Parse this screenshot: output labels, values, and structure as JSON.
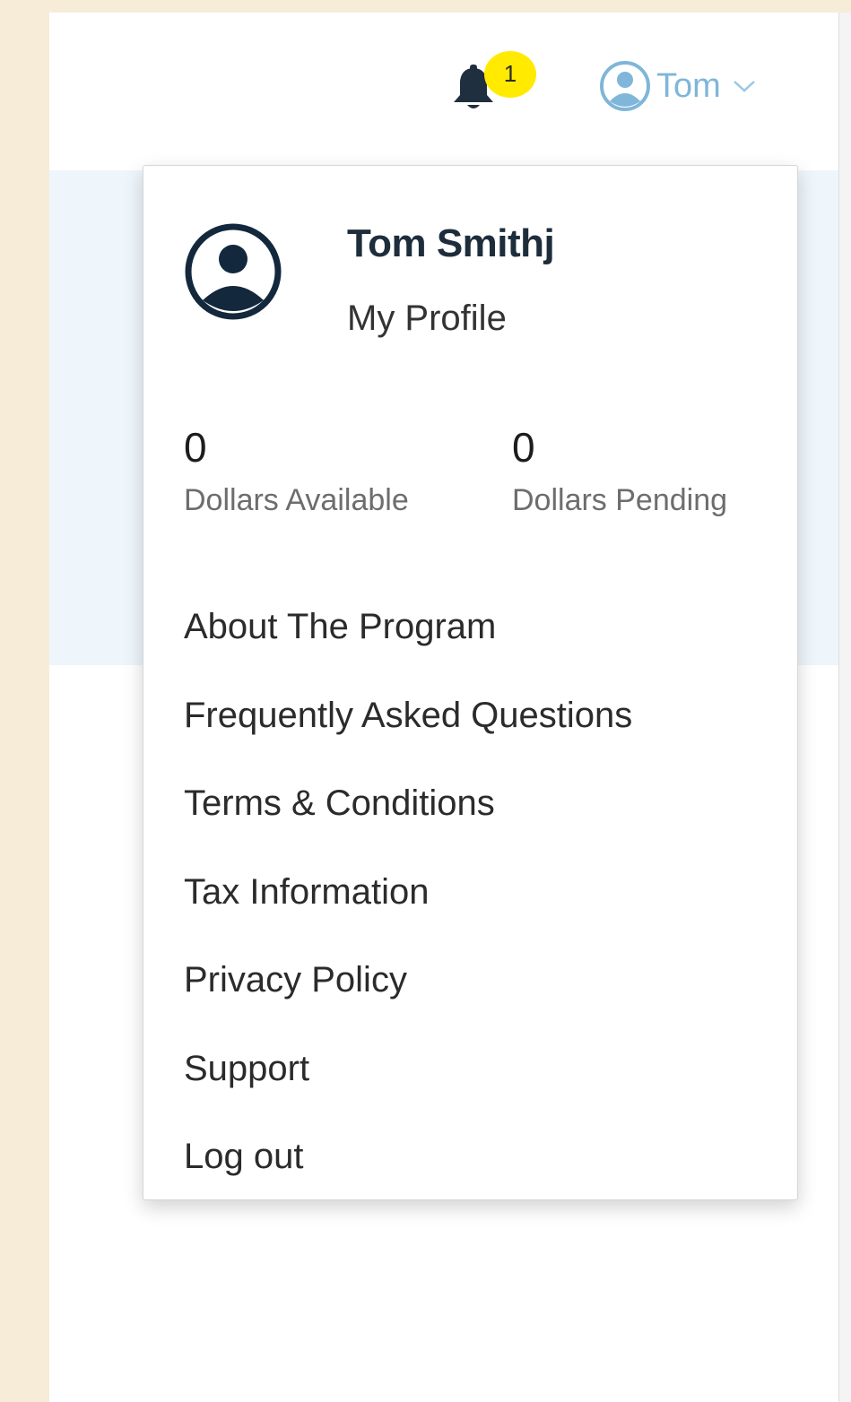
{
  "header": {
    "notifications": {
      "icon": "bell-icon",
      "count": "1",
      "badge_color": "#ffea00"
    },
    "user_menu": {
      "icon": "user-circle-icon",
      "name": "Tom",
      "chevron_icon": "chevron-down-icon",
      "accent_color": "#7fb6d9"
    }
  },
  "dropdown": {
    "avatar_icon": "user-circle-icon",
    "full_name": "Tom Smithj",
    "profile_link": "My Profile",
    "stats": {
      "available": {
        "value": "0",
        "label": "Dollars Available"
      },
      "pending": {
        "value": "0",
        "label": "Dollars Pending"
      }
    },
    "menu_items": [
      {
        "label": "About The Program"
      },
      {
        "label": "Frequently Asked Questions"
      },
      {
        "label": "Terms & Conditions"
      },
      {
        "label": "Tax Information"
      },
      {
        "label": "Privacy Policy"
      },
      {
        "label": "Support"
      },
      {
        "label": "Log out"
      }
    ]
  }
}
